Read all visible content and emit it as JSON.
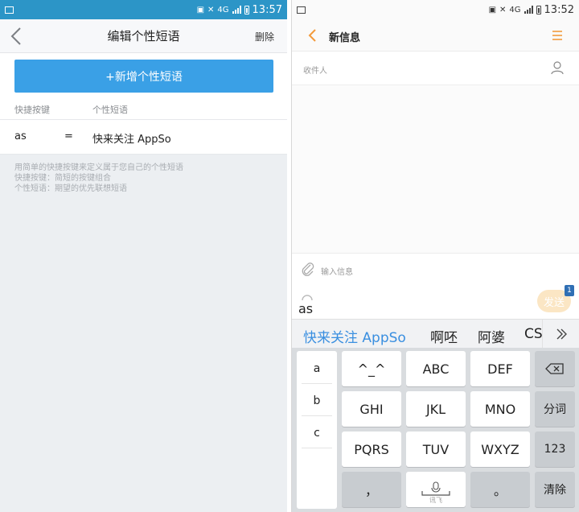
{
  "left": {
    "status_time": "13:57",
    "status_net": "4G",
    "title": "编辑个性短语",
    "delete_label": "删除",
    "add_button": "+新增个性短语",
    "col_shortcut": "快捷按键",
    "col_phrase": "个性短语",
    "row": {
      "key": "as",
      "eq": "=",
      "phrase": "快来关注 AppSo"
    },
    "help": [
      "用简单的快捷按键来定义属于您自己的个性短语",
      "快捷按键：简短的按键组合",
      "个性短语：期望的优先联想短语"
    ]
  },
  "right": {
    "status_time": "13:52",
    "status_net": "4G",
    "title": "新信息",
    "recipient_placeholder": "收件人",
    "input_placeholder": "输入信息",
    "send_label": "发送",
    "send_badge": "1",
    "composing": "as",
    "candidates": [
      "快来关注 AppSo",
      "啊呸",
      "阿婆",
      "CS"
    ],
    "side_keys": [
      "a",
      "b",
      "c"
    ],
    "keys": {
      "r1": [
        "^_^",
        "ABC",
        "DEF"
      ],
      "r2": [
        "GHI",
        "JKL",
        "MNO"
      ],
      "r3": [
        "PQRS",
        "TUV",
        "WXYZ"
      ],
      "fn_r2": "分词",
      "fn_r3": "123",
      "comma": "，",
      "period": "。",
      "clear": "清除",
      "space_sub": "讯飞"
    }
  },
  "colors": {
    "left_statusbar": "#2c95c7",
    "add_button": "#3aa0e6",
    "accent_orange": "#f39a3b",
    "candidate_highlight": "#3a8fe0",
    "send_bg": "#fbe6c4",
    "badge": "#2f6fb4"
  }
}
